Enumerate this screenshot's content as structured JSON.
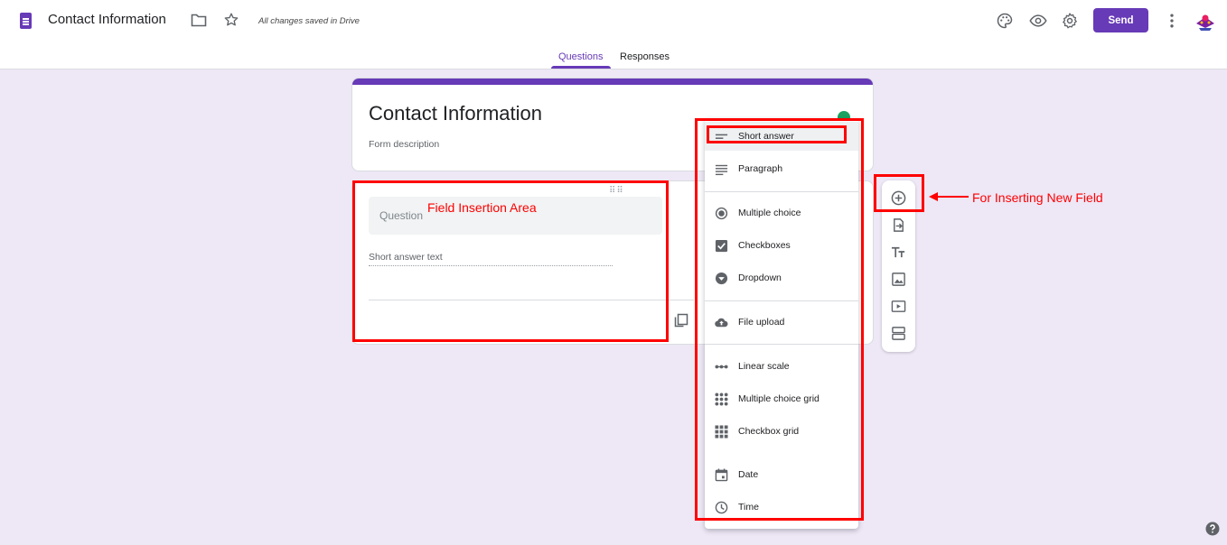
{
  "header": {
    "title": "Contact Information",
    "saved_status": "All changes saved in Drive",
    "send_label": "Send",
    "icons": [
      "docs-form-icon",
      "folder-icon",
      "star-icon",
      "palette-icon",
      "eye-icon",
      "gear-icon",
      "more-vert-icon",
      "avatar"
    ]
  },
  "tabs": [
    {
      "label": "Questions",
      "active": true
    },
    {
      "label": "Responses",
      "active": false
    }
  ],
  "form": {
    "title": "Contact Information",
    "description_placeholder": "Form description",
    "question": {
      "placeholder": "Question",
      "answer_hint": "Short answer text"
    }
  },
  "question_types": {
    "items": [
      {
        "label": "Short answer",
        "icon": "short-answer-icon",
        "selected": true
      },
      {
        "label": "Paragraph",
        "icon": "paragraph-icon"
      },
      {
        "label": "Multiple choice",
        "icon": "radio-icon"
      },
      {
        "label": "Checkboxes",
        "icon": "checkbox-icon"
      },
      {
        "label": "Dropdown",
        "icon": "dropdown-icon"
      },
      {
        "label": "File upload",
        "icon": "cloud-upload-icon"
      },
      {
        "label": "Linear scale",
        "icon": "linear-scale-icon"
      },
      {
        "label": "Multiple choice grid",
        "icon": "radio-grid-icon"
      },
      {
        "label": "Checkbox grid",
        "icon": "checkbox-grid-icon"
      },
      {
        "label": "Date",
        "icon": "calendar-icon"
      },
      {
        "label": "Time",
        "icon": "clock-icon"
      }
    ]
  },
  "toolbar": {
    "icons": [
      "add-question-icon",
      "import-questions-icon",
      "title-text-icon",
      "image-icon",
      "video-icon",
      "section-icon"
    ]
  },
  "annotations": {
    "field_area": "Field Insertion Area",
    "insert_field": "For Inserting New Field"
  },
  "colors": {
    "accent": "#673ab7",
    "background": "#ede7f6",
    "annotation": "#ff0000"
  }
}
